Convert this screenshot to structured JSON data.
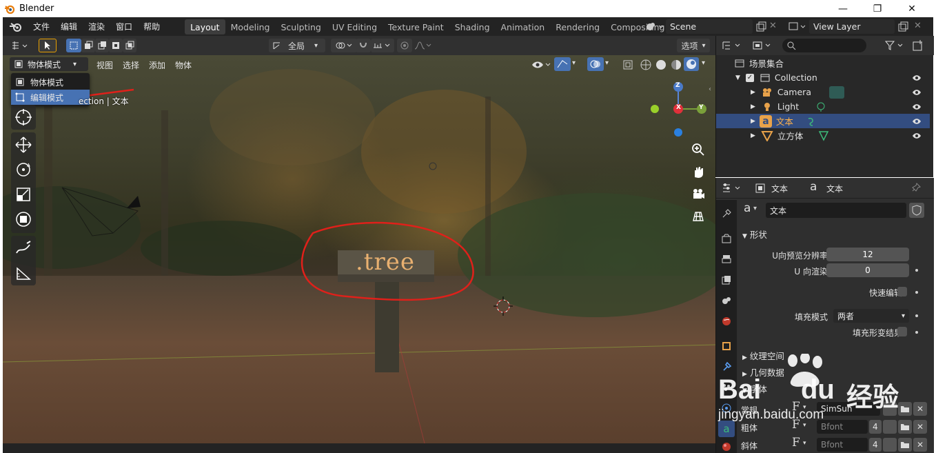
{
  "window": {
    "title": "Blender",
    "minimize": "—",
    "maximize": "❐",
    "close": "✕"
  },
  "menubar": {
    "items": [
      "文件",
      "编辑",
      "渲染",
      "窗口",
      "帮助"
    ],
    "workspaces": [
      "Layout",
      "Modeling",
      "Sculpting",
      "UV Editing",
      "Texture Paint",
      "Shading",
      "Animation",
      "Rendering",
      "Compositing"
    ],
    "active_workspace": "Layout",
    "scene": "Scene",
    "view_layer": "View Layer"
  },
  "viewport_header": {
    "transform_orientation": "全局",
    "options": "选项"
  },
  "viewport": {
    "mode": "物体模式",
    "menus": [
      "视图",
      "选择",
      "添加",
      "物体"
    ],
    "mode_dropdown": [
      "物体模式",
      "编辑模式"
    ],
    "highlighted_option": "编辑模式",
    "info_text": "ection | 文本",
    "sign_text": ".tree",
    "gizmo_axes": {
      "z": "Z",
      "y": "Y",
      "x": "X"
    }
  },
  "outliner": {
    "root": "场景集合",
    "items": [
      {
        "name": "Collection",
        "icon": "collection-icon",
        "selected": false
      },
      {
        "name": "Camera",
        "icon": "camera-icon",
        "selected": false
      },
      {
        "name": "Light",
        "icon": "light-icon",
        "selected": false
      },
      {
        "name": "文本",
        "icon": "text-object-icon",
        "selected": true
      },
      {
        "name": "立方体",
        "icon": "mesh-icon",
        "selected": false
      }
    ]
  },
  "properties": {
    "header_object": "文本",
    "header_data": "文本",
    "datablock_name": "文本",
    "section_shape": "形状",
    "fields": [
      {
        "label": "U向预览分辨率",
        "value": "12"
      },
      {
        "label": "U 向渲染",
        "value": "0"
      }
    ],
    "fast_edit": "快速编辑",
    "fill_mode_label": "填充模式",
    "fill_mode_value": "两者",
    "fill_deform": "填充形变结果",
    "collapsed_sections": [
      "纹理空间",
      "几何数据",
      "字体"
    ],
    "font_rows": [
      {
        "label": "常规",
        "font": "SimSun",
        "users": ""
      },
      {
        "label": "粗体",
        "font": "Bfont",
        "users": "4"
      },
      {
        "label": "斜体",
        "font": "Bfont",
        "users": "4"
      }
    ]
  },
  "watermark": {
    "brand_a": "Bai",
    "brand_b": "du",
    "cn": "经验",
    "url": "jingyan.baidu.com"
  },
  "colors": {
    "accent_blue": "#4772b3",
    "annotation_red": "#e0201a",
    "panel_bg": "#303030"
  }
}
